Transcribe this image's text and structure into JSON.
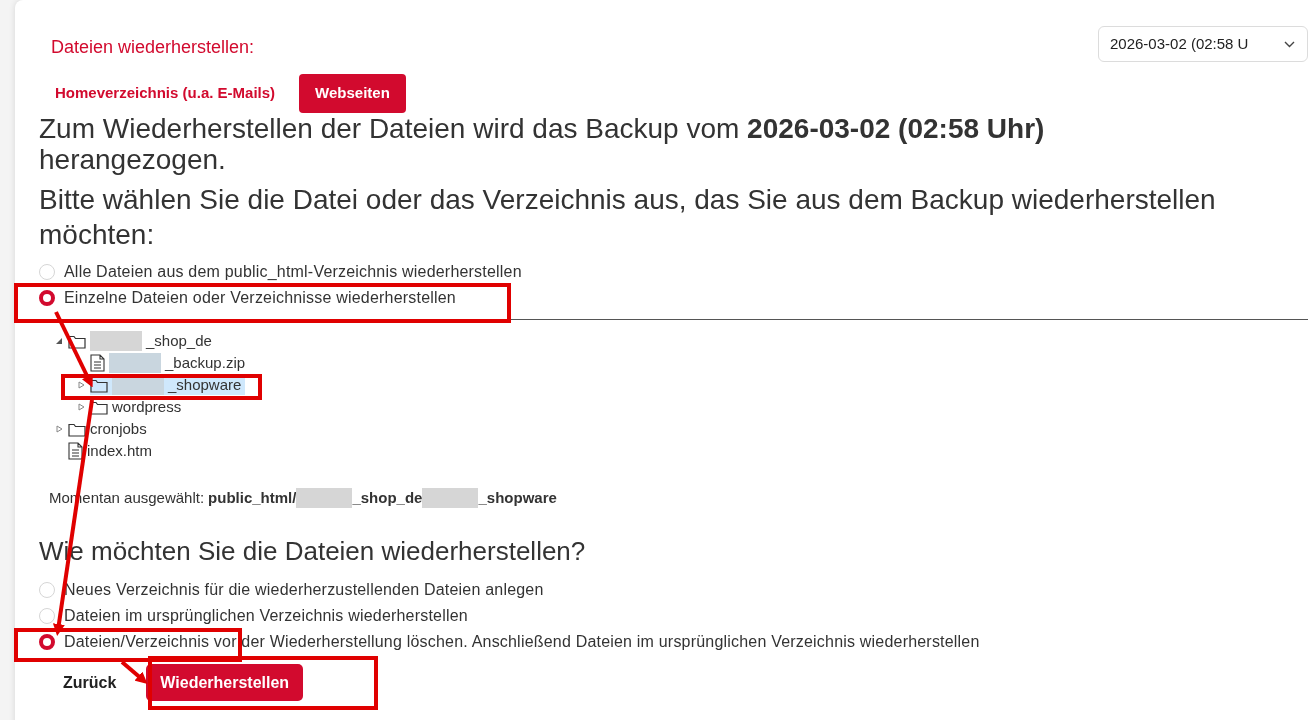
{
  "title": "Dateien wiederherstellen:",
  "tabs": [
    {
      "label": "Homeverzeichnis (u.a. E-Mails)",
      "selected": false
    },
    {
      "label": "Webseiten",
      "selected": true
    }
  ],
  "backup_select": {
    "value": "2026-03-02 (02:58 U"
  },
  "intro": "Zum Wiederherstellen der Dateien wird das Backup vom **2026-03-02 (02:58 Uhr)** herangezogen.",
  "prompt": "Bitte wählen Sie die Datei oder das Verzeichnis aus, das Sie aus dem Backup wiederherstellen möchten:",
  "scope_options": [
    {
      "label": "Alle Dateien aus dem public_html-Verzeichnis wiederherstellen",
      "selected": false
    },
    {
      "label": "Einzelne Dateien oder Verzeichnisse wiederherstellen",
      "selected": true
    }
  ],
  "tree": [
    {
      "kind": "folder",
      "name": "_shop_de",
      "redacted": true,
      "expanded": true,
      "selected": false,
      "children": [
        {
          "kind": "file",
          "name": "_backup.zip",
          "redacted": true,
          "selected": false
        },
        {
          "kind": "folder",
          "name": "_shopware",
          "redacted": true,
          "expanded": false,
          "selected": true
        },
        {
          "kind": "folder",
          "name": "wordpress",
          "redacted": false,
          "expanded": false,
          "selected": false
        }
      ]
    },
    {
      "kind": "folder",
      "name": "cronjobs",
      "redacted": false,
      "expanded": false,
      "selected": false
    },
    {
      "kind": "file",
      "name": "index.htm",
      "redacted": false,
      "selected": false
    }
  ],
  "current_selection": {
    "label": "Momentan ausgewählt:",
    "parts": [
      "public_html/",
      "_shop_de",
      "_shopware"
    ]
  },
  "method_heading": "Wie möchten Sie die Dateien wiederherstellen?",
  "method_options": [
    {
      "label": "Neues Verzeichnis für die wiederherzustellenden Dateien anlegen",
      "selected": false
    },
    {
      "label": "Dateien im ursprünglichen Verzeichnis wiederherstellen",
      "selected": false
    },
    {
      "label": "Dateien/Verzeichnis vor der Wiederherstellung löschen. Anschließend Dateien im ursprünglichen Verzeichnis wiederherstellen",
      "selected": true
    }
  ],
  "buttons": {
    "back": "Zurück",
    "restore": "Wiederherstellen"
  }
}
